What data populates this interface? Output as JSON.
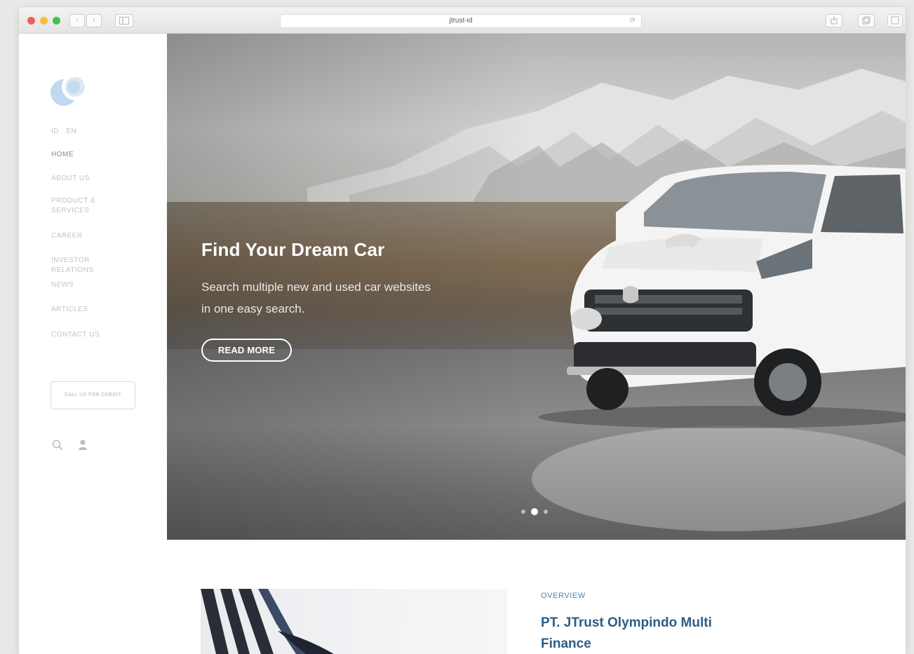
{
  "browser": {
    "address": "jtrust-id",
    "nav_back": "‹",
    "nav_forward": "›",
    "colors": {
      "close": "#f25d57",
      "minimize": "#f6bd3a",
      "zoom": "#3fc345"
    }
  },
  "sidebar": {
    "menu": [
      {
        "label": "ID · EN",
        "active": false
      },
      {
        "label": "HOME",
        "active": true
      },
      {
        "label": "ABOUT US",
        "active": false
      },
      {
        "label": "PRODUCT & SERVICES",
        "active": false
      },
      {
        "label": "CAREER",
        "active": false
      },
      {
        "label": "INVESTOR RELATIONS",
        "active": false
      },
      {
        "label": "NEWS",
        "active": false
      },
      {
        "label": "ARTICLES",
        "active": false
      },
      {
        "label": "CONTACT US",
        "active": false
      }
    ],
    "contact_button": "CALL US FOR CREDIT",
    "icons": [
      "search-icon",
      "user-icon"
    ]
  },
  "hero": {
    "title": "Find Your Dream Car",
    "subtitle": "Search multiple new and used car websites in one easy search.",
    "button": "READ MORE",
    "slides": 3,
    "active_slide": 2
  },
  "overview": {
    "label": "OVERVIEW",
    "title": "PT. JTrust Olympindo Multi Finance"
  },
  "colors": {
    "accent_blue": "#2c5d86",
    "label_blue": "#4a86b4"
  }
}
